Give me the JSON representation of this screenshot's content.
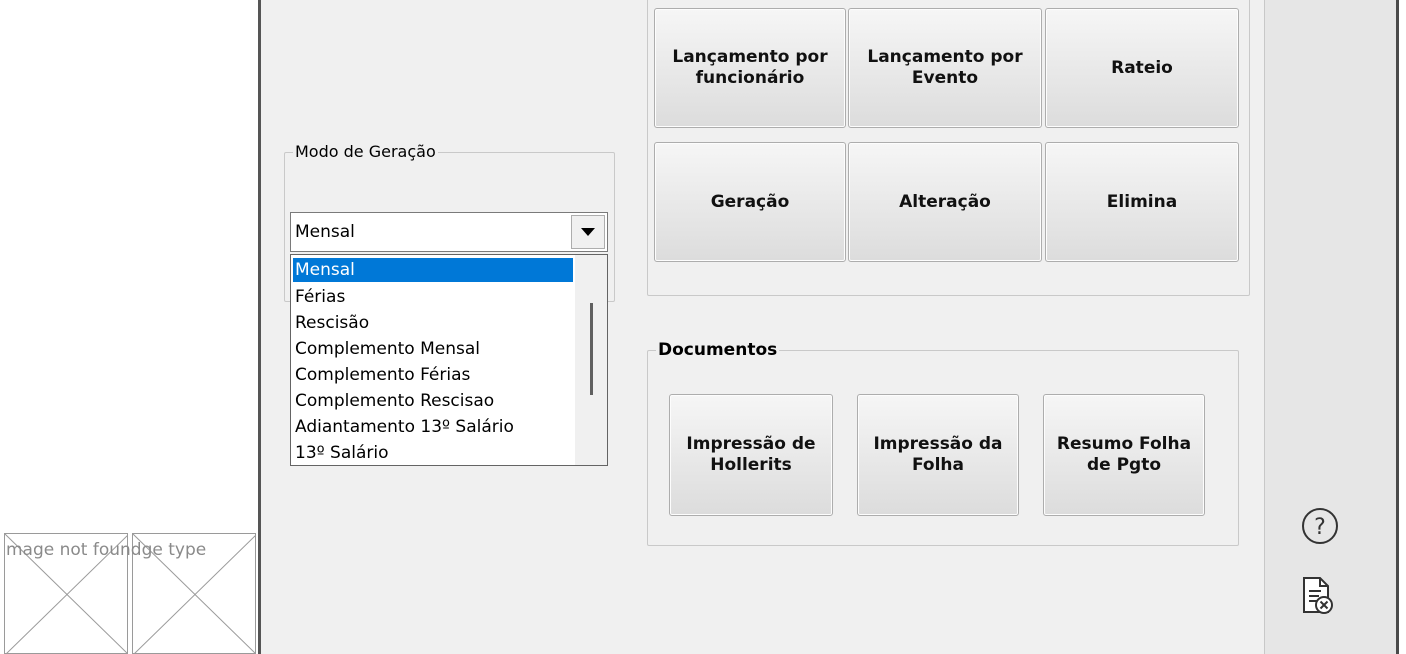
{
  "modo_geracao": {
    "legend": "Modo de Geração",
    "selected": "Mensal",
    "options": [
      "Mensal",
      "Férias",
      "Rescisão",
      "Complemento Mensal",
      "Complemento Férias",
      "Complemento Rescisao",
      "Adiantamento 13º Salário",
      "13º Salário"
    ]
  },
  "actions": {
    "lancamento_funcionario": "Lançamento por\nfuncionário",
    "lancamento_evento": "Lançamento por\nEvento",
    "rateio": "Rateio",
    "geracao": "Geração",
    "alteracao": "Alteração",
    "elimina": "Elimina"
  },
  "documentos": {
    "legend": "Documentos",
    "impressao_hollerits": "Impressão de\nHollerits",
    "impressao_folha": "Impressão da\nFolha",
    "resumo_folha": "Resumo Folha\nde Pgto"
  },
  "broken_images": {
    "text": "mage not foundge type"
  },
  "icons": {
    "help": "help-circle-icon",
    "doc_cancel": "document-cancel-icon"
  },
  "colors": {
    "selection": "#0078d7",
    "panel_bg": "#f0f0f0"
  }
}
